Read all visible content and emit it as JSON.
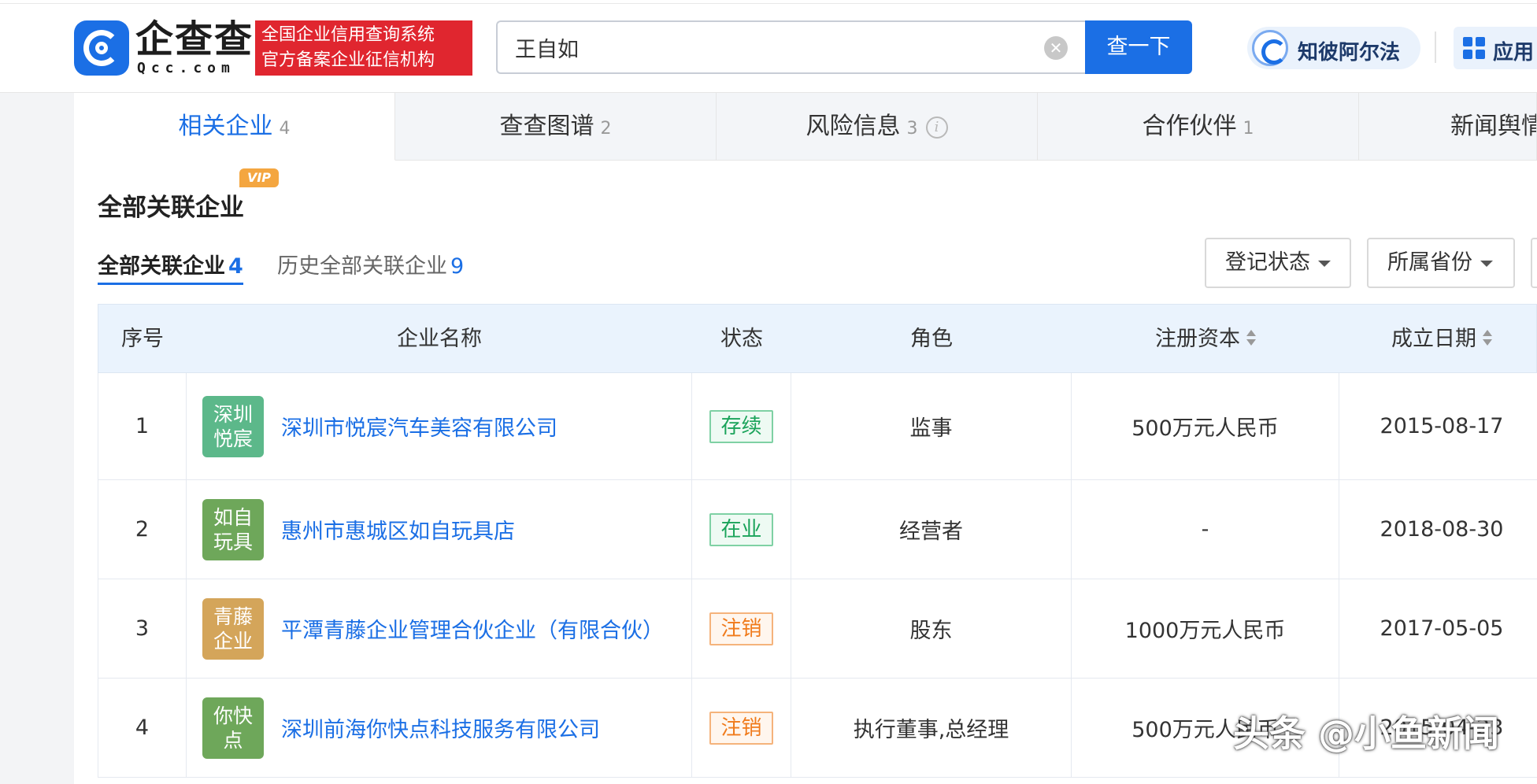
{
  "header": {
    "logo_text": "企查查",
    "logo_sub": "Qcc.com",
    "slogan_line1": "全国企业信用查询系统",
    "slogan_line2": "官方备案企业征信机构",
    "search_value": "王自如",
    "search_button": "查一下",
    "ai_label": "知彼阿尔法",
    "app_label": "应用"
  },
  "tabs": [
    {
      "label": "相关企业",
      "count": "4"
    },
    {
      "label": "查查图谱",
      "count": "2"
    },
    {
      "label": "风险信息",
      "count": "3"
    },
    {
      "label": "合作伙伴",
      "count": "1"
    },
    {
      "label": "新闻舆情",
      "count": ""
    }
  ],
  "section": {
    "title": "全部关联企业",
    "vip": "VIP",
    "subtabs": [
      {
        "label": "全部关联企业",
        "count": "4"
      },
      {
        "label": "历史全部关联企业",
        "count": "9"
      }
    ],
    "filters": [
      "登记状态",
      "所属省份"
    ]
  },
  "table": {
    "columns": [
      "序号",
      "企业名称",
      "状态",
      "角色",
      "注册资本",
      "成立日期"
    ],
    "rows": [
      {
        "index": "1",
        "logo_line1": "深圳",
        "logo_line2": "悦宸",
        "logo_color": "#5cb88a",
        "name": "深圳市悦宸汽车美容有限公司",
        "status": "存续",
        "status_type": "ok",
        "role": "监事",
        "capital": "500万元人民币",
        "date": "2015-08-17"
      },
      {
        "index": "2",
        "logo_line1": "如自",
        "logo_line2": "玩具",
        "logo_color": "#6ea75a",
        "name": "惠州市惠城区如自玩具店",
        "status": "在业",
        "status_type": "ok",
        "role": "经营者",
        "capital": "-",
        "date": "2018-08-30"
      },
      {
        "index": "3",
        "logo_line1": "青藤",
        "logo_line2": "企业",
        "logo_color": "#d4a55a",
        "name": "平潭青藤企业管理合伙企业（有限合伙）",
        "status": "注销",
        "status_type": "cancel",
        "role": "股东",
        "capital": "1000万元人民币",
        "date": "2017-05-05"
      },
      {
        "index": "4",
        "logo_line1": "你快",
        "logo_line2": "点",
        "logo_color": "#6ea75a",
        "name": "深圳前海你快点科技服务有限公司",
        "status": "注销",
        "status_type": "cancel",
        "role": "执行董事,总经理",
        "capital": "500万元人民币",
        "date": "2015-04-23"
      }
    ]
  },
  "watermark": "头条 @小鱼新闻"
}
